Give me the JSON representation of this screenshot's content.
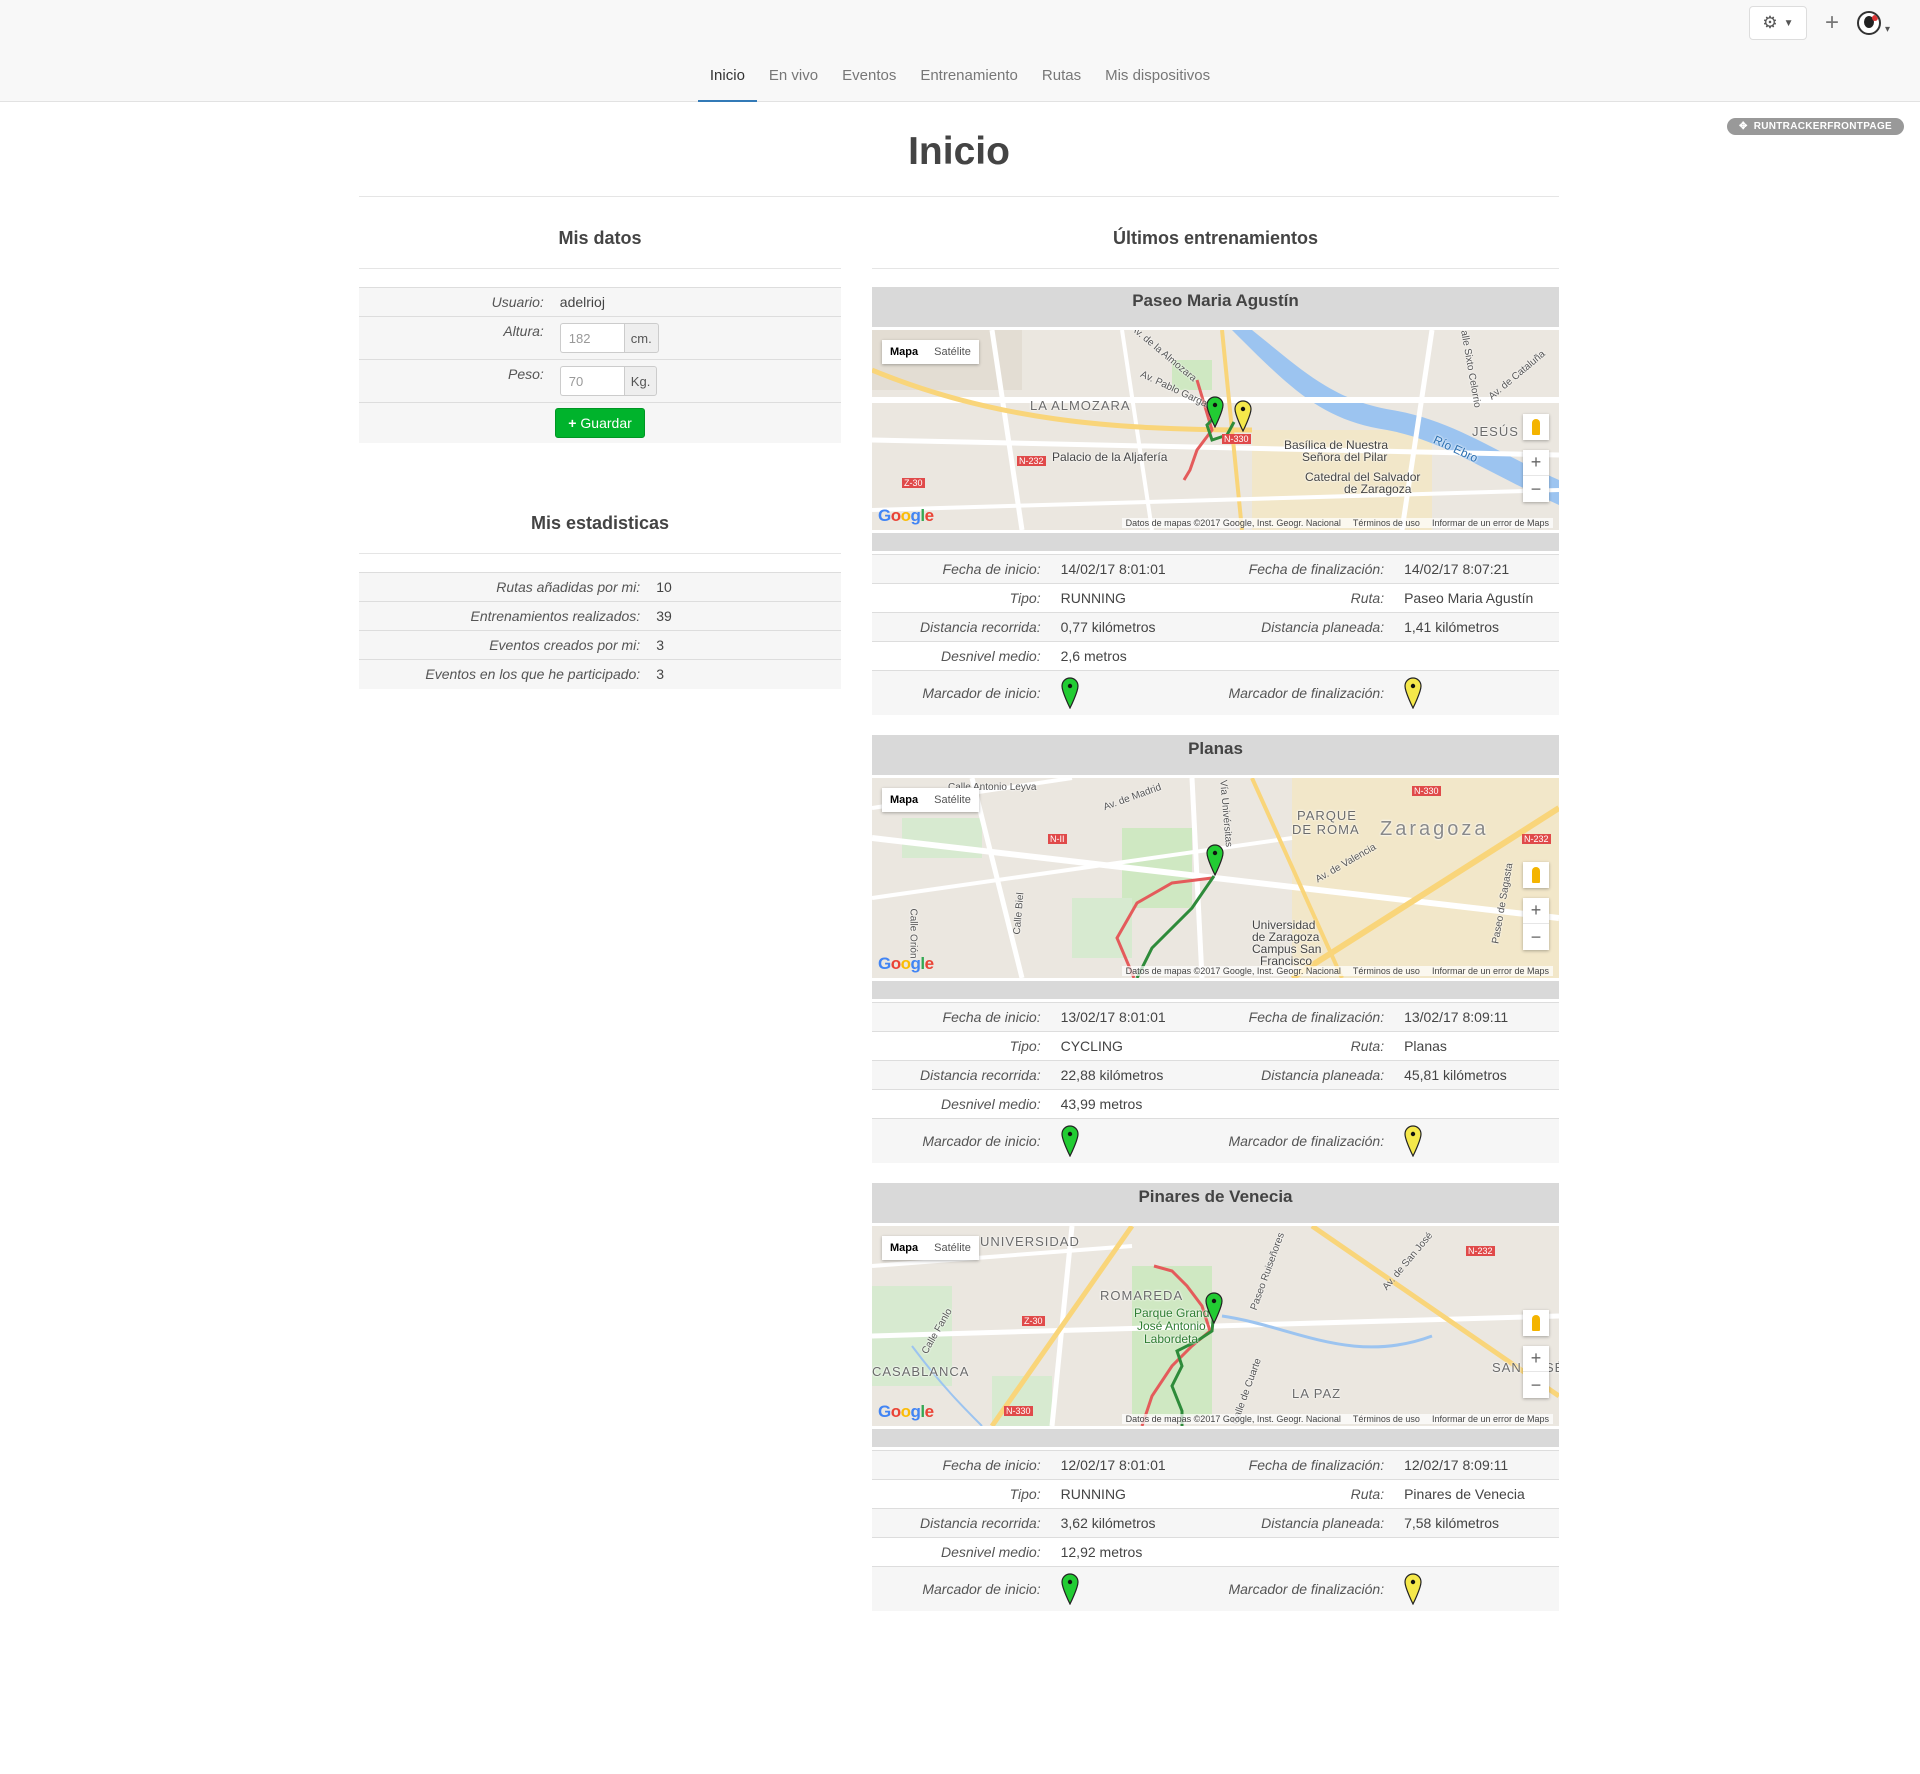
{
  "nav": {
    "items": [
      {
        "label": "Inicio",
        "active": true
      },
      {
        "label": "En vivo"
      },
      {
        "label": "Eventos"
      },
      {
        "label": "Entrenamiento"
      },
      {
        "label": "Rutas"
      },
      {
        "label": "Mis dispositivos"
      }
    ]
  },
  "portlet_badge": "RUNTRACKERFRONTPAGE",
  "page_title": "Inicio",
  "mis_datos": {
    "title": "Mis datos",
    "usuario_label": "Usuario:",
    "usuario_value": "adelrioj",
    "altura_label": "Altura:",
    "altura_placeholder": "182",
    "altura_unit": "cm.",
    "peso_label": "Peso:",
    "peso_placeholder": "70",
    "peso_unit": "Kg.",
    "save_label": "Guardar"
  },
  "mis_estadisticas": {
    "title": "Mis estadisticas",
    "rows": [
      {
        "label": "Rutas añadidas por mi:",
        "value": "10"
      },
      {
        "label": "Entrenamientos realizados:",
        "value": "39"
      },
      {
        "label": "Eventos creados por mi:",
        "value": "3"
      },
      {
        "label": "Eventos en los que he participado:",
        "value": "3"
      }
    ]
  },
  "ultimos": {
    "title": "Últimos entrenamientos",
    "labels": {
      "fecha_inicio": "Fecha de inicio:",
      "fecha_fin": "Fecha de finalización:",
      "tipo": "Tipo:",
      "ruta": "Ruta:",
      "distancia_recorrida": "Distancia recorrida:",
      "distancia_planeada": "Distancia planeada:",
      "desnivel": "Desnivel medio:",
      "marcador_inicio": "Marcador de inicio:",
      "marcador_fin": "Marcador de finalización:"
    },
    "map_ui": {
      "mapa": "Mapa",
      "satelite": "Satélite",
      "attribution": "Datos de mapas ©2017 Google, Inst. Geogr. Nacional",
      "terms": "Términos de uso",
      "report": "Informar de un error de Maps"
    },
    "colors": {
      "start_marker": "#22cc33",
      "end_marker": "#f5e84a",
      "track_done": "#2e8b3a",
      "track_planned": "#e45b5b"
    },
    "trainings": [
      {
        "title": "Paseo Maria Agustín",
        "fecha_inicio": "14/02/17 8:01:01",
        "fecha_fin": "14/02/17 8:07:21",
        "tipo": "RUNNING",
        "ruta": "Paseo Maria Agustín",
        "distancia_recorrida": "0,77 kilómetros",
        "distancia_planeada": "1,41 kilómetros",
        "desnivel": "2,6 metros",
        "map_labels": [
          "LA ALMOZARA",
          "Palacio de la Aljafería",
          "Basílica de Nuestra",
          "Señora del Pilar",
          "Catedral del Salvador",
          "de Zaragoza",
          "JESÚS",
          "Río Ebro",
          "Av. de la Almozara",
          "Av. Pablo Gargallo",
          "Calle Sixto Celorrio",
          "Av. de Cataluña",
          "N-330",
          "N-232",
          "Z-30"
        ]
      },
      {
        "title": "Planas",
        "fecha_inicio": "13/02/17 8:01:01",
        "fecha_fin": "13/02/17 8:09:11",
        "tipo": "CYCLING",
        "ruta": "Planas",
        "distancia_recorrida": "22,88 kilómetros",
        "distancia_planeada": "45,81 kilómetros",
        "desnivel": "43,99 metros",
        "map_labels": [
          "PARQUE",
          "DE ROMA",
          "Zaragoza",
          "Universidad",
          "de Zaragoza",
          "Campus San",
          "Francisco",
          "Av. de Madrid",
          "Vía Univérsitas",
          "Av. de Valencia",
          "Paseo de Sagasta",
          "Calle Antonio Leyva",
          "Calle Orión",
          "Calle Biel",
          "N-II",
          "N-330",
          "N-232"
        ]
      },
      {
        "title": "Pinares de Venecia",
        "fecha_inicio": "12/02/17 8:01:01",
        "fecha_fin": "12/02/17 8:09:11",
        "tipo": "RUNNING",
        "ruta": "Pinares de Venecia",
        "distancia_recorrida": "3,62 kilómetros",
        "distancia_planeada": "7,58 kilómetros",
        "desnivel": "12,92 metros",
        "map_labels": [
          "UNIVERSIDAD",
          "ROMAREDA",
          "Parque Grande",
          "José Antonio",
          "Labordeta",
          "CASABLANCA",
          "LA PAZ",
          "SAN JOSÉ",
          "Paseo Ruiseñores",
          "Calle de Cuarte",
          "Av. de San José",
          "Calle Fanlo",
          "Z-30",
          "N-330",
          "N-232"
        ]
      }
    ]
  }
}
